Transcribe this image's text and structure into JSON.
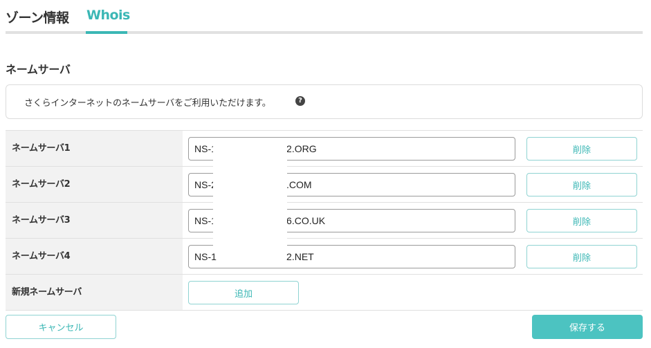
{
  "tabs": [
    {
      "label": "ゾーン情報",
      "active": false
    },
    {
      "label": "Whois",
      "active": true
    }
  ],
  "section": {
    "title": "ネームサーバ",
    "info": "さくらインターネットのネームサーバをご利用いただけます。"
  },
  "nameservers": [
    {
      "label": "ネームサーバ1",
      "value": "NS-1                          2.ORG",
      "delete_label": "削除"
    },
    {
      "label": "ネームサーバ2",
      "value": "NS-2                          .COM",
      "delete_label": "削除"
    },
    {
      "label": "ネームサーバ3",
      "value": "NS-1                          6.CO.UK",
      "delete_label": "削除"
    },
    {
      "label": "ネームサーバ4",
      "value": "NS-1                          2.NET",
      "delete_label": "削除"
    }
  ],
  "new_ns": {
    "label": "新規ネームサーバ",
    "add_label": "追加"
  },
  "footer": {
    "cancel_label": "キャンセル",
    "save_label": "保存する"
  },
  "colors": {
    "accent": "#3bb7b5",
    "save_bg": "#4cc3c1",
    "label_bg": "#f2f2f2"
  }
}
